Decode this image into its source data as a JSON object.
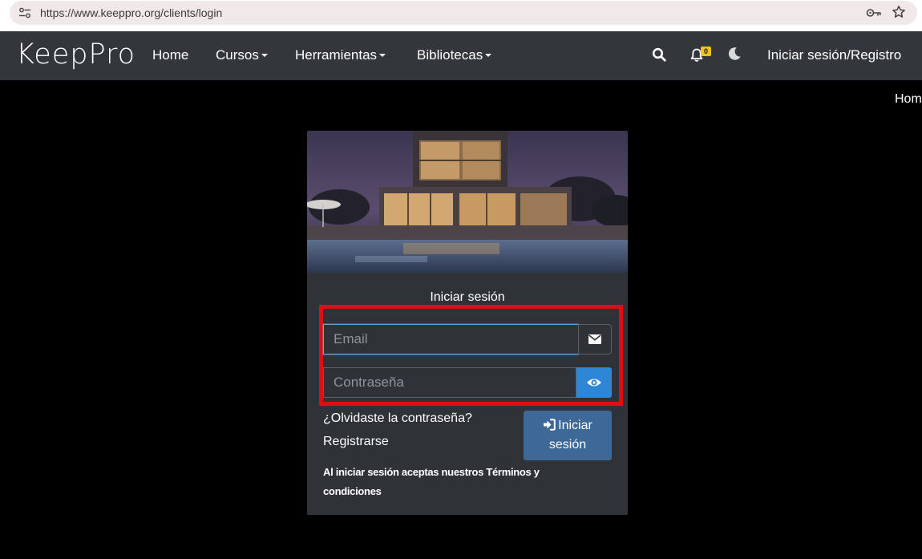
{
  "browser": {
    "url": "https://www.keeppro.org/clients/login",
    "icons": [
      "site-settings-icon",
      "password-key-icon",
      "bookmark-star-icon"
    ]
  },
  "navbar": {
    "logo": "KeepPro",
    "home": "Home",
    "cursos": "Cursos",
    "herramientas": "Herramientas",
    "bibliotecas": "Bibliotecas",
    "notification_count": "0",
    "login_register": "Iniciar sesión/Registro",
    "icons": [
      "search-icon",
      "bell-icon",
      "moon-icon"
    ]
  },
  "breadcrumb": "Hom",
  "login_card": {
    "title": "Iniciar sesión",
    "email_placeholder": "Email",
    "email_value": "",
    "password_placeholder": "Contraseña",
    "password_value": "",
    "forgot_password": "¿Olvidaste la contraseña?",
    "register": "Registrarse",
    "submit_label": "Iniciar sesión",
    "terms": "Al iniciar sesión aceptas nuestros Términos y condiciones",
    "icons": [
      "envelope-icon",
      "eye-icon",
      "sign-in-icon"
    ]
  },
  "colors": {
    "navbar_bg": "#33373b",
    "card_bg": "#2f3337",
    "page_bg": "#000000",
    "highlight": "#e00d13",
    "eye_button": "#2e86d6",
    "submit_button": "#3d6898",
    "badge": "#f0c419"
  }
}
